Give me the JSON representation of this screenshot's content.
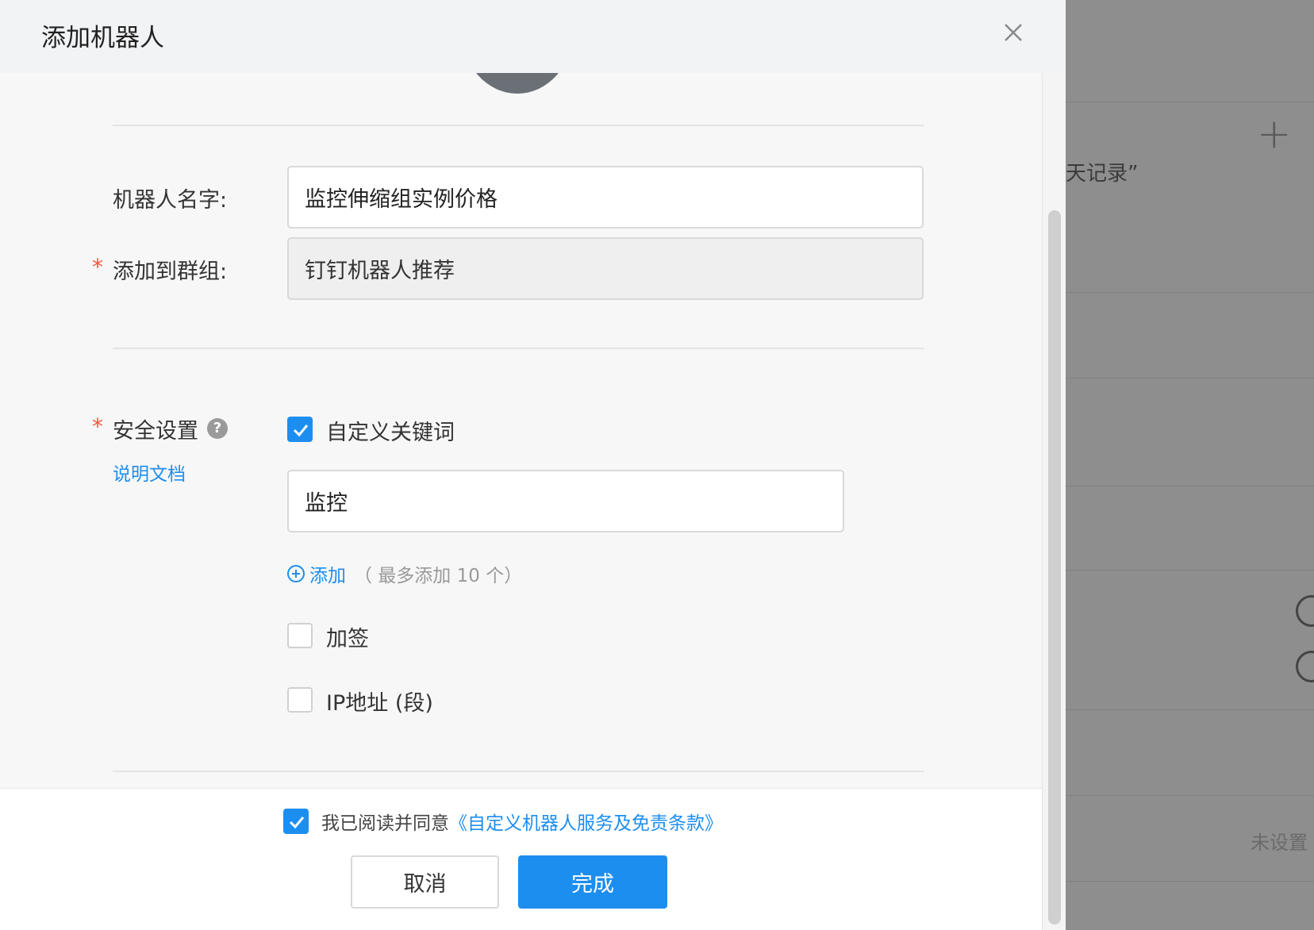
{
  "dialog": {
    "title": "添加机器人"
  },
  "form": {
    "name_label": "机器人名字:",
    "name_value": "监控伸缩组实例价格",
    "group_required_mark": "*",
    "group_label": "添加到群组:",
    "group_value": "钉钉机器人推荐",
    "security_required_mark": "*",
    "security_label": "安全设置",
    "security_help_glyph": "?",
    "doc_link": "说明文档",
    "keyword_checkbox_label": "自定义关键词",
    "keyword_value": "监控",
    "add_link": "添加",
    "add_hint": "（ 最多添加 10 个）",
    "sign_checkbox_label": "加签",
    "ip_checkbox_label": "IP地址 (段)",
    "keyword_checked": true,
    "sign_checked": false,
    "ip_checked": false
  },
  "footer": {
    "agree_text": "我已阅读并同意",
    "agree_link": "《自定义机器人服务及免责条款》",
    "agree_checked": true,
    "cancel_label": "取消",
    "ok_label": "完成"
  },
  "background": {
    "plus_glyph": "+",
    "record_text": "天记录”",
    "unset_text": "未设置"
  },
  "colors": {
    "accent": "#1c8ef0",
    "required": "#f25643",
    "overlay": "#8e8e8e"
  }
}
